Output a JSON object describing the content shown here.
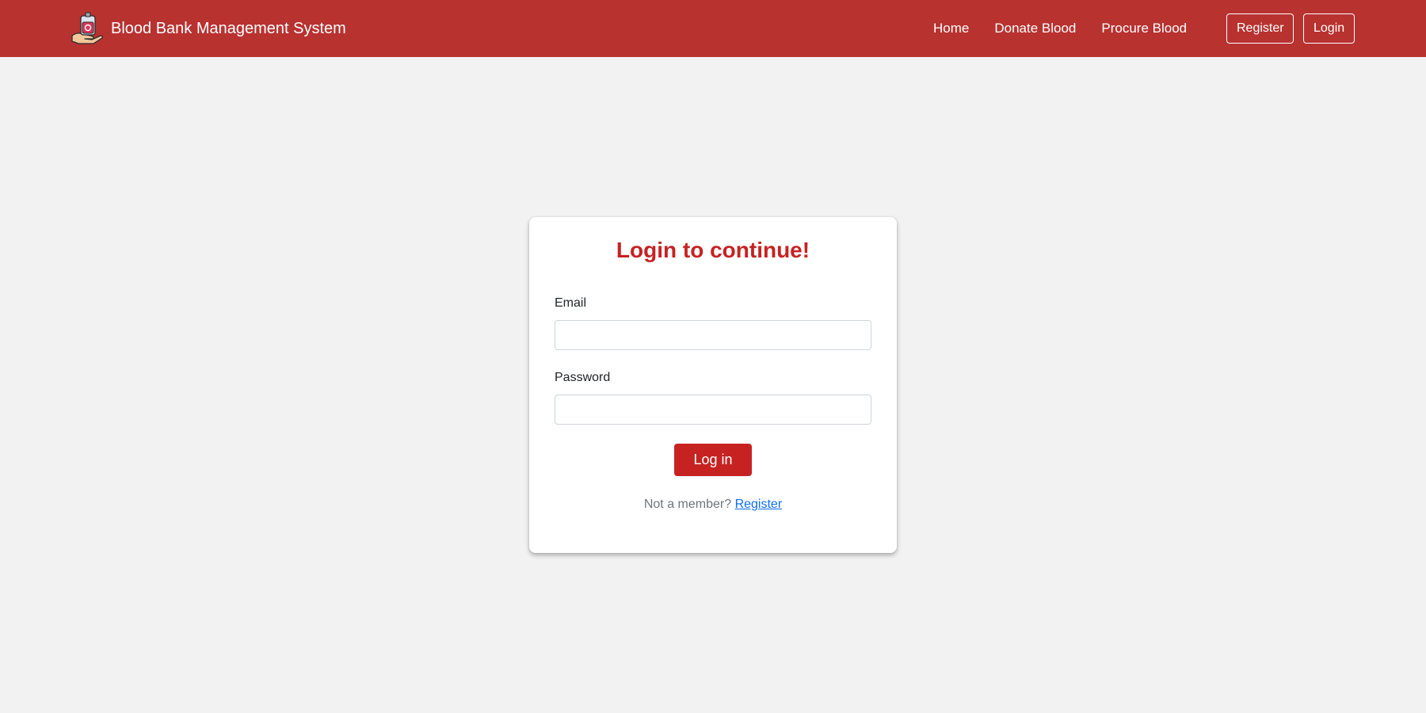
{
  "navbar": {
    "brand_title": "Blood Bank Management System",
    "brand_icon": "blood-bag-in-hand-icon",
    "background_color": "#b83230",
    "links": [
      {
        "label": "Home"
      },
      {
        "label": "Donate Blood"
      },
      {
        "label": "Procure Blood"
      }
    ],
    "register_button": "Register",
    "login_button": "Login"
  },
  "login_card": {
    "title": "Login to continue!",
    "accent_color": "#c62222",
    "email": {
      "label": "Email",
      "value": "",
      "placeholder": ""
    },
    "password": {
      "label": "Password",
      "value": "",
      "placeholder": ""
    },
    "submit_label": "Log in",
    "footer_text": "Not a member?",
    "footer_link": "Register"
  }
}
